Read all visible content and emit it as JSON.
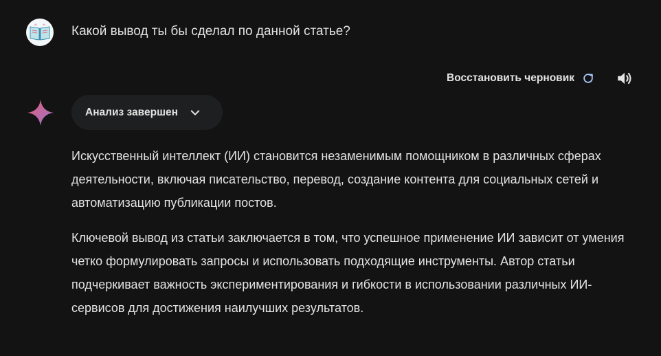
{
  "user_message": {
    "text": "Какой вывод ты бы сделал по данной статье?"
  },
  "toolbar": {
    "restore_draft_label": "Восстановить черновик"
  },
  "analysis_chip": {
    "label": "Анализ завершен"
  },
  "response": {
    "paragraphs": [
      "Искусственный интеллект (ИИ) становится незаменимым помощником в различных сферах деятельности, включая писательство, перевод, создание контента для социальных сетей и автоматизацию публикации постов.",
      "Ключевой вывод из статьи заключается в том, что успешное применение ИИ зависит от умения четко формулировать запросы и использовать подходящие инструменты. Автор статьи подчеркивает важность экспериментирования и гибкости в использовании различных ИИ-сервисов для достижения наилучших результатов."
    ]
  },
  "icons": {
    "avatar": "book-avatar-icon",
    "refresh": "refresh-icon",
    "speaker": "speaker-icon",
    "assistant": "gemini-sparkle-icon",
    "chevron": "chevron-down-icon"
  },
  "colors": {
    "background": "#131314",
    "text": "#e3e3e3",
    "chip_background": "#1e1f20",
    "accent_blue": "#a8c7fa",
    "sparkle_start": "#e2607a",
    "sparkle_end": "#9b72cb"
  }
}
